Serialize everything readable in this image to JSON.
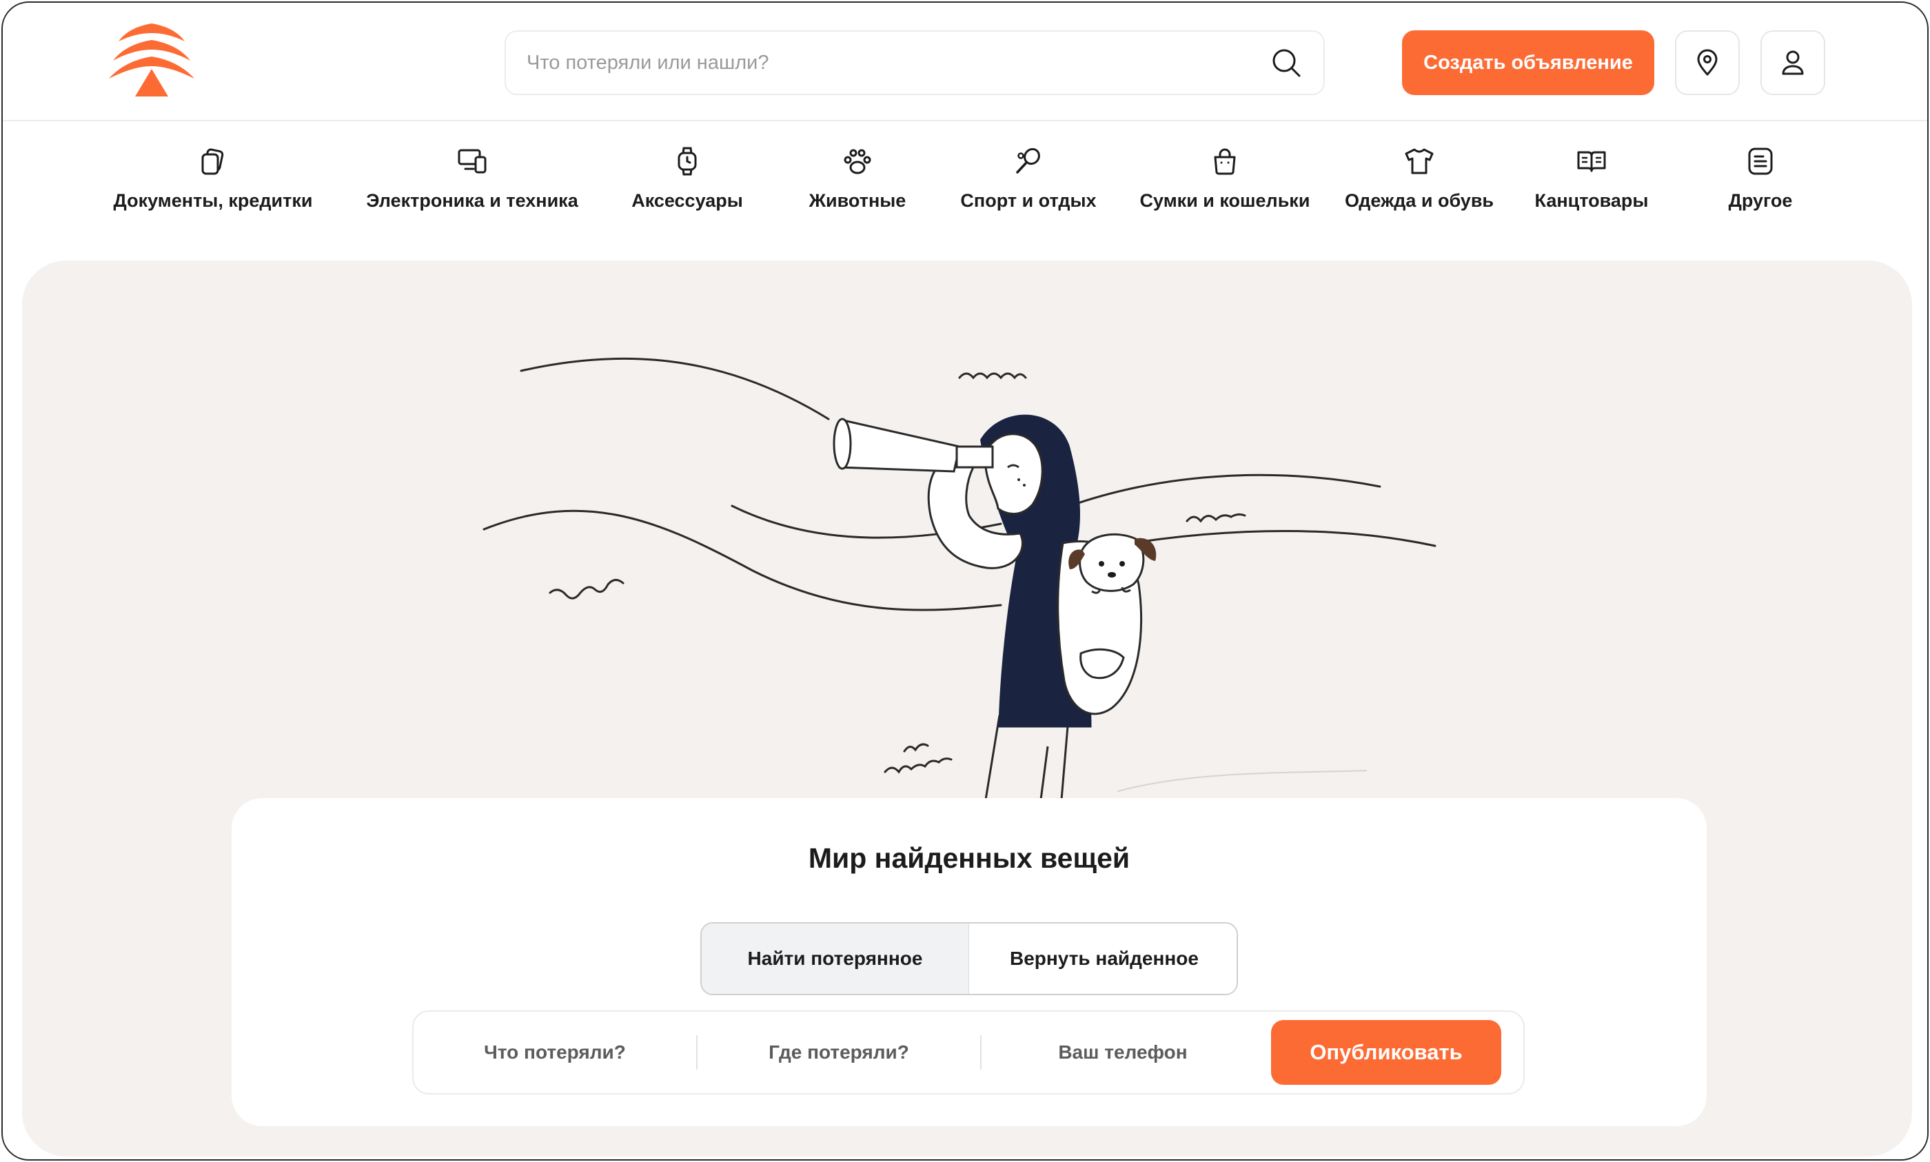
{
  "colors": {
    "accent": "#fd6b35",
    "hero_bg": "#f4f1ee",
    "navy": "#1a2340"
  },
  "header": {
    "logo_icon": "tree-logo-icon",
    "search": {
      "placeholder": "Что потеряли или нашли?",
      "icon": "search-icon"
    },
    "create_button": "Создать объявление",
    "location_icon": "location-pin-icon",
    "user_icon": "user-icon"
  },
  "categories": [
    {
      "label": "Документы, кредитки",
      "icon": "documents-icon"
    },
    {
      "label": "Электроника и техника",
      "icon": "devices-icon"
    },
    {
      "label": "Аксессуары",
      "icon": "watch-icon"
    },
    {
      "label": "Животные",
      "icon": "paw-icon"
    },
    {
      "label": "Спорт и отдых",
      "icon": "racket-icon"
    },
    {
      "label": "Сумки и кошельки",
      "icon": "bag-icon"
    },
    {
      "label": "Одежда и обувь",
      "icon": "tshirt-icon"
    },
    {
      "label": "Канцтовары",
      "icon": "book-icon"
    },
    {
      "label": "Другое",
      "icon": "list-icon"
    }
  ],
  "hero": {
    "illustration": "woman-with-telescope-illustration",
    "title": "Мир найденных вещей",
    "tabs": [
      {
        "label": "Найти потерянное",
        "active": true
      },
      {
        "label": "Вернуть найденное",
        "active": false
      }
    ],
    "form": {
      "what_lost": "Что потеряли?",
      "where_lost": "Где потеряли?",
      "phone": "Ваш телефон",
      "publish_button": "Опубликовать"
    }
  }
}
